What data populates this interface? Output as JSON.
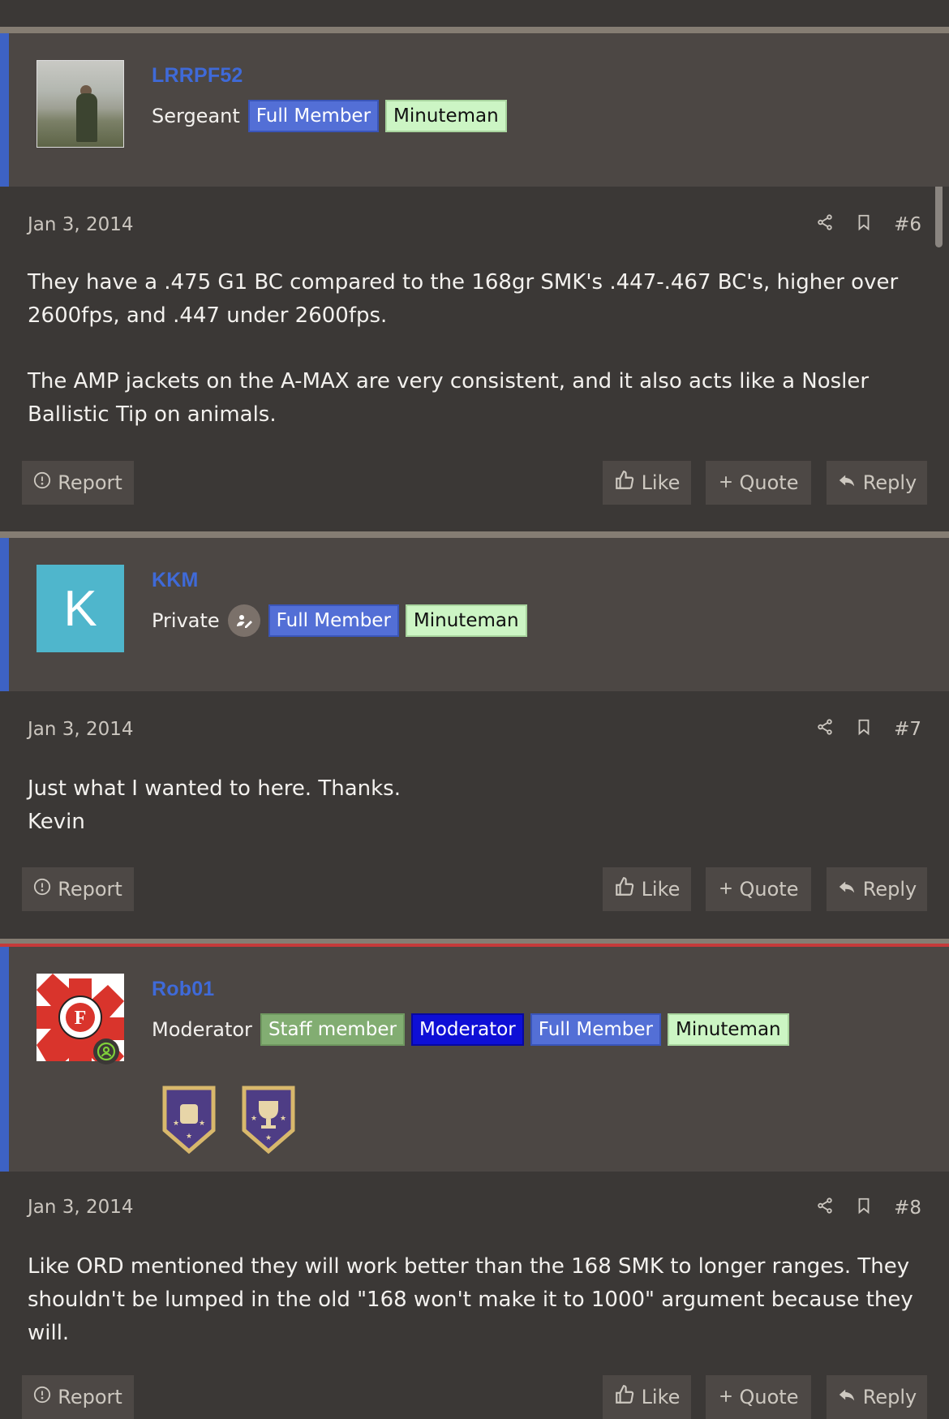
{
  "posts": [
    {
      "username": "LRRPF52",
      "user_title": "Sergeant",
      "avatar_letter": "",
      "badges": [
        "Full Member",
        "Minuteman"
      ],
      "date": "Jan 3, 2014",
      "post_number": "#6",
      "body": [
        "They have a .475 G1 BC compared to the 168gr SMK's .447-.467 BC's, higher over 2600fps, and .447 under 2600fps.",
        "The AMP jackets on the A-MAX are very consistent, and it also acts like a Nosler Ballistic Tip on animals."
      ]
    },
    {
      "username": "KKM",
      "user_title": "Private",
      "avatar_letter": "K",
      "badges": [
        "Full Member",
        "Minuteman"
      ],
      "date": "Jan 3, 2014",
      "post_number": "#7",
      "body": [
        "Just what I wanted to here. Thanks.",
        "Kevin"
      ]
    },
    {
      "username": "Rob01",
      "user_title": "Moderator",
      "avatar_letter": "",
      "badges": [
        "Staff member",
        "Moderator",
        "Full Member",
        "Minuteman"
      ],
      "date": "Jan 3, 2014",
      "post_number": "#8",
      "body": [
        "Like ORD mentioned they will work better than the 168 SMK to longer ranges. They shouldn't be lumped in the old \"168 won't make it to 1000\" argument because they will."
      ]
    }
  ],
  "actions": {
    "report": "Report",
    "like": "Like",
    "quote": "Quote",
    "reply": "Reply"
  },
  "icons": {
    "share": "share-icon",
    "bookmark": "bookmark-icon",
    "report": "alert-circle-icon",
    "like": "thumbs-up-icon",
    "quote": "plus-icon",
    "reply": "reply-arrow-icon",
    "online": "online-user-icon",
    "role": "pen-user-icon",
    "trophy1": "armor-trophy-icon",
    "trophy2": "cup-trophy-icon"
  },
  "colors": {
    "accent": "#3d62c4",
    "username": "#3f6ad8",
    "moderator_separator": "#c53a3a"
  }
}
